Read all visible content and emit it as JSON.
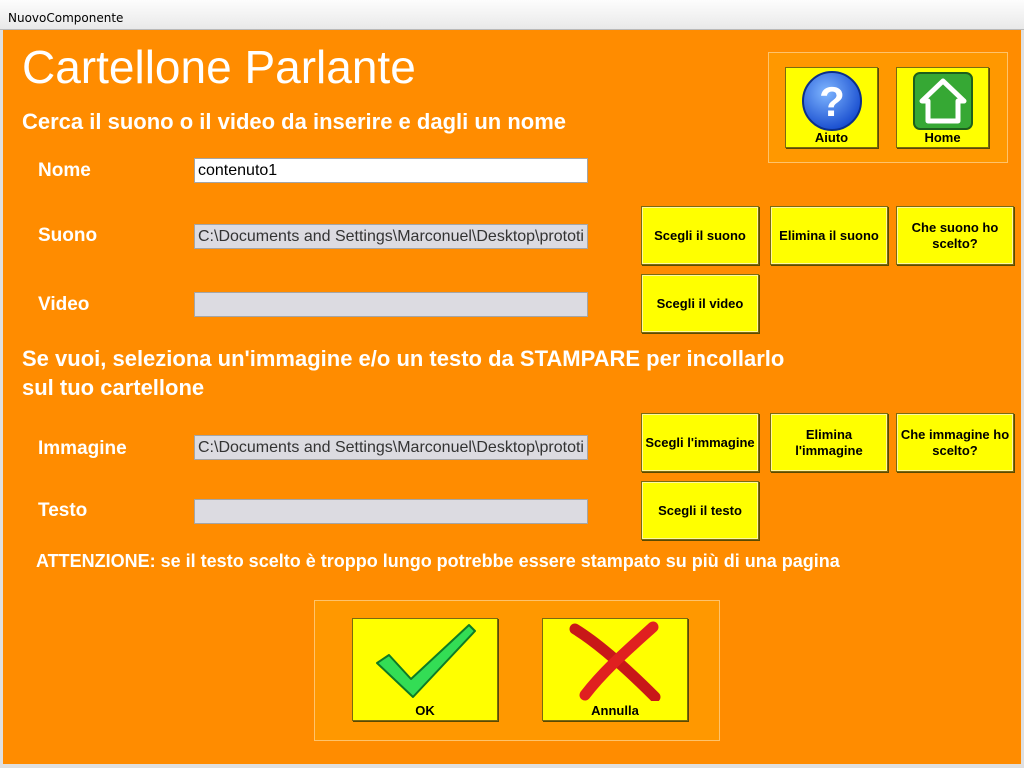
{
  "window": {
    "title": "NuovoComponente"
  },
  "header": {
    "title": "Cartellone Parlante",
    "subtitle": "Cerca il suono o il video da inserire e dagli un nome"
  },
  "nav": {
    "help_label": "Aiuto",
    "home_label": "Home"
  },
  "fields": {
    "nome": {
      "label": "Nome",
      "value": "contenuto1"
    },
    "suono": {
      "label": "Suono",
      "value": "C:\\Documents and Settings\\Marconuel\\Desktop\\prototi"
    },
    "video": {
      "label": "Video",
      "value": ""
    },
    "immagine": {
      "label": "Immagine",
      "value": "C:\\Documents and Settings\\Marconuel\\Desktop\\prototi"
    },
    "testo": {
      "label": "Testo",
      "value": ""
    }
  },
  "buttons": {
    "choose_sound": "Scegli il suono",
    "delete_sound": "Elimina il suono",
    "which_sound": "Che suono ho scelto?",
    "choose_video": "Scegli il video",
    "choose_image": "Scegli l'immagine",
    "delete_image": "Elimina l'immagine",
    "which_image": "Che immagine ho scelto?",
    "choose_text": "Scegli il testo",
    "ok": "OK",
    "cancel": "Annulla"
  },
  "section2": {
    "line1": "Se vuoi, seleziona un'immagine e/o un testo da STAMPARE per incollarlo",
    "line2": "sul tuo cartellone"
  },
  "warning": "ATTENZIONE: se il testo scelto è troppo lungo potrebbe essere stampato su più di una pagina",
  "colors": {
    "background": "#ff8c00",
    "button": "#ffff00",
    "help_icon": "#1a5fd6",
    "home_icon": "#36a834",
    "ok_icon": "#33dd55",
    "cancel_icon": "#e02020"
  }
}
